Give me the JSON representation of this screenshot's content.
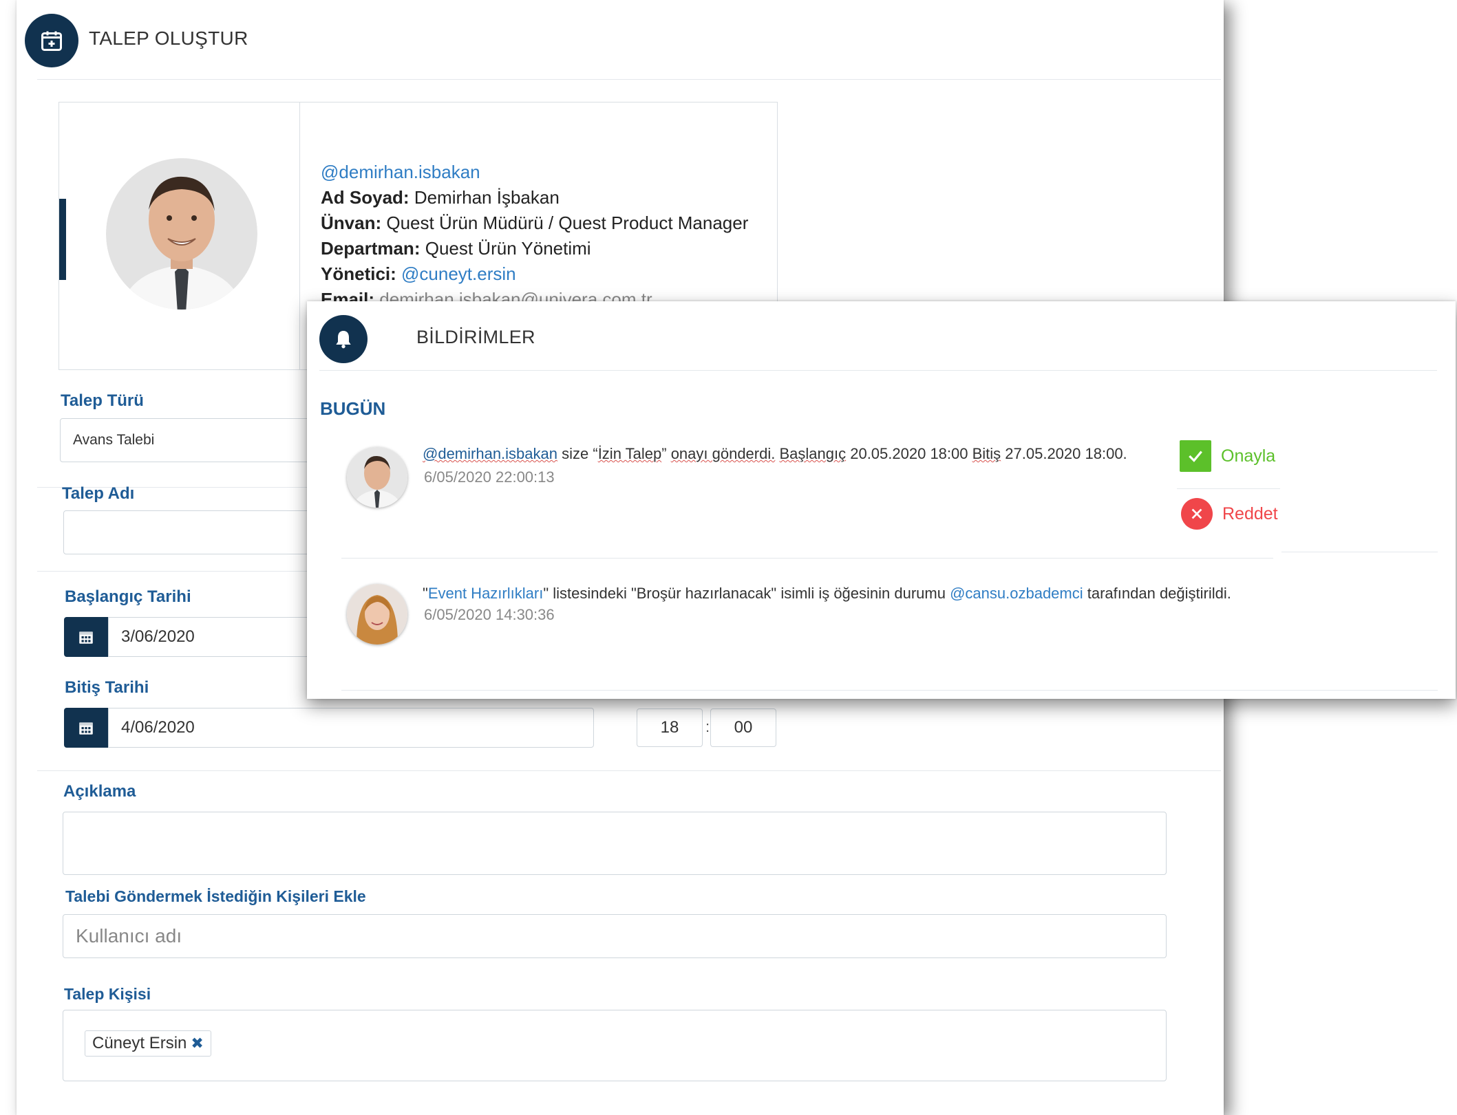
{
  "form": {
    "title": "TALEP OLUŞTUR",
    "profile": {
      "username": "@demirhan.isbakan",
      "name_label": "Ad Soyad:",
      "name_value": "Demirhan İşbakan",
      "title_label": "Ünvan:",
      "title_value": "Quest Ürün Müdürü / Quest Product Manager",
      "department_label": "Departman:",
      "department_value": "Quest Ürün Yönetimi",
      "manager_label": "Yönetici:",
      "manager_value": "@cuneyt.ersin",
      "email_label": "Email:",
      "email_value": "demirhan.isbakan@univera.com.tr"
    },
    "request_type": {
      "label": "Talep Türü",
      "value": "Avans Talebi"
    },
    "request_name": {
      "label": "Talep Adı",
      "value": ""
    },
    "start_date": {
      "label": "Başlangıç Tarihi",
      "value": "3/06/2020"
    },
    "end_date": {
      "label": "Bitiş Tarihi",
      "value": "4/06/2020",
      "hour": "18",
      "separator": ":",
      "minute": "00"
    },
    "description": {
      "label": "Açıklama",
      "value": ""
    },
    "add_people": {
      "label": "Talebi Göndermek İstediğin Kişileri Ekle",
      "placeholder": "Kullanıcı adı"
    },
    "request_person": {
      "label": "Talep Kişisi",
      "chips": [
        "Cüneyt Ersin"
      ]
    }
  },
  "notifications": {
    "title": "BİLDİRİMLER",
    "section": "BUGÜN",
    "items": [
      {
        "user": "@demirhan.isbakan",
        "text_1": " size “",
        "text_2": "İzin Talep",
        "text_3": "” ",
        "text_4": "onayı gönderdi.",
        "text_5": " ",
        "text_6": "Başlangıç",
        "text_7": " 20.05.2020 18:00 ",
        "text_8": "Bitiş",
        "text_9": " 27.05.2020 18:00.",
        "time": "6/05/2020 22:00:13",
        "approve_label": "Onayla",
        "reject_label": "Reddet"
      },
      {
        "quote_open": "\"",
        "list_name": "Event Hazırlıkları",
        "text_1": "\" listesindeki \"Broşür hazırlanacak\" isimli iş öğesinin durumu ",
        "user": "@cansu.ozbademci",
        "text_2": " tarafından değiştirildi.",
        "time": "6/05/2020 14:30:36"
      }
    ]
  },
  "colors": {
    "navy": "#11324f",
    "label_blue": "#1f5c96",
    "link_blue": "#2f7dc4",
    "approve_green": "#5cc02a",
    "reject_red": "#f0464a"
  },
  "icons": [
    "calendar-plus-icon",
    "calendar-icon",
    "bell-icon",
    "check-icon",
    "close-icon",
    "remove-icon"
  ]
}
